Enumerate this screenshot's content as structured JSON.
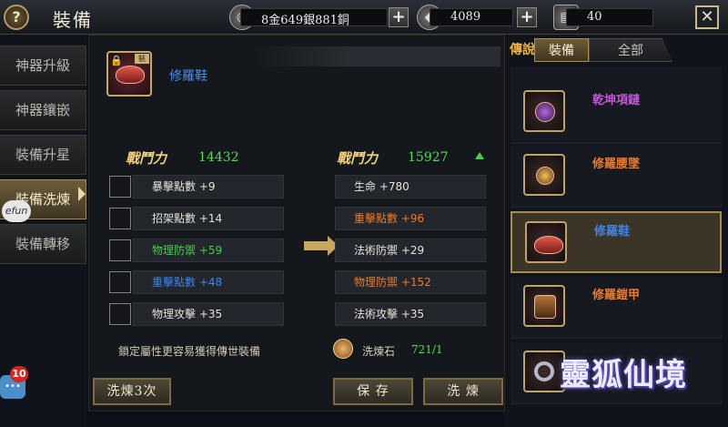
{
  "header": {
    "help_icon": "?",
    "title": "裝備",
    "money": "8金649銀881銅",
    "diamonds": "4089",
    "tokens": "40",
    "plus": "+",
    "close": "✕"
  },
  "nav": {
    "items": [
      "神器升級",
      "神器鑲嵌",
      "裝備升星",
      "裝備洗煉",
      "裝備轉移"
    ],
    "active": "裝備洗煉"
  },
  "floating": {
    "efun_label": "efun",
    "chat_badge": "10"
  },
  "item": {
    "name": "修羅鞋",
    "lock_icon": "lock-icon",
    "tag_icon": "tag-icon"
  },
  "before": {
    "power_label": "戰鬥力",
    "power_value": "14432",
    "attributes": [
      {
        "text": "暴擊點數 +9",
        "color": "white"
      },
      {
        "text": "招架點數 +14",
        "color": "white"
      },
      {
        "text": "物理防禦 +59",
        "color": "green"
      },
      {
        "text": "重擊點數 +48",
        "color": "blue"
      },
      {
        "text": "物理攻擊 +35",
        "color": "white"
      }
    ]
  },
  "after": {
    "power_label": "戰鬥力",
    "power_value": "15927",
    "attributes": [
      {
        "text": "生命 +780",
        "color": "white"
      },
      {
        "text": "重擊點數 +96",
        "color": "orange"
      },
      {
        "text": "法術防禦 +29",
        "color": "white"
      },
      {
        "text": "物理防禦 +152",
        "color": "orange"
      },
      {
        "text": "法術攻擊 +35",
        "color": "white"
      }
    ]
  },
  "footer": {
    "hint": "鎖定屬性更容易獲得傳世裝備",
    "stone_label": "洗煉石",
    "stone_count": "721/1",
    "btn_refine3": "洗煉3次",
    "btn_save": "保 存",
    "btn_refine": "洗 煉"
  },
  "right": {
    "tab_legend": "傳說",
    "tab_equip": "裝備",
    "tab_all": "全部",
    "items": [
      {
        "name": "乾坤項鏈",
        "color": "purple"
      },
      {
        "name": "修羅腰墜",
        "color": "orange"
      },
      {
        "name": "修羅鞋",
        "color": "blue"
      },
      {
        "name": "修羅鎧甲",
        "color": "orange"
      }
    ]
  },
  "logo": "靈狐仙境",
  "colors": {
    "green": "#3fcf48",
    "blue": "#3e84e8",
    "orange": "#ec7a2a",
    "purple": "#c25ad6",
    "gold": "#f1d27a"
  }
}
